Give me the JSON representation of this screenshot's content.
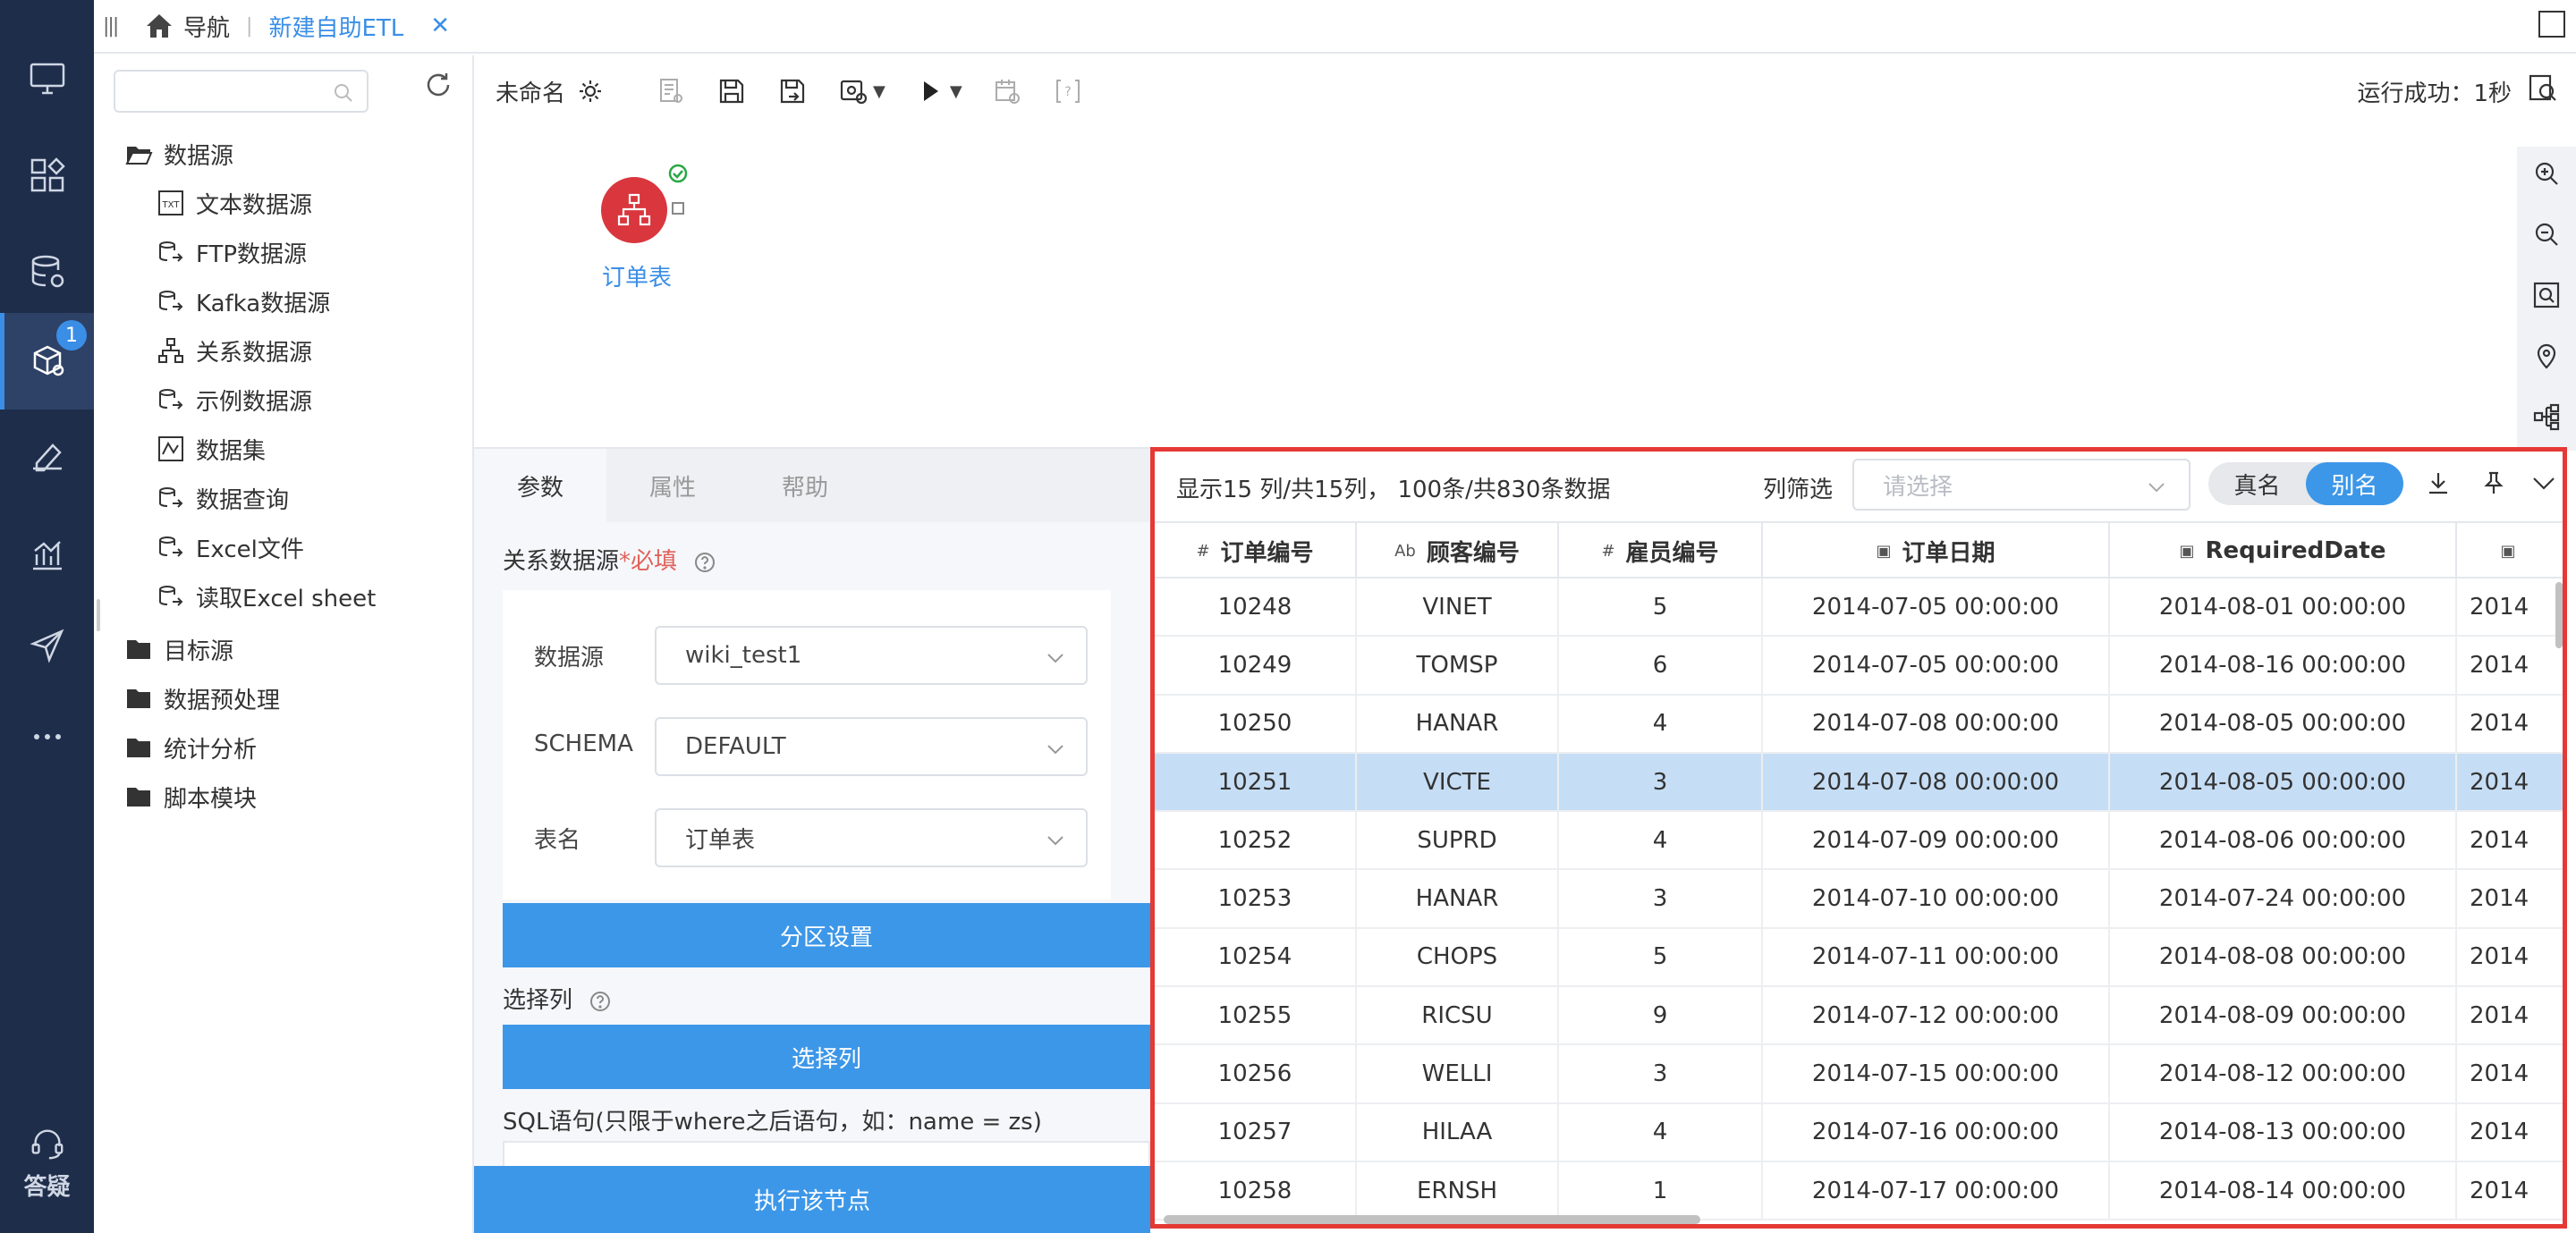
{
  "topbar": {
    "nav_label": "导航",
    "separator": "|",
    "active_tab": "新建自助ETL",
    "close_glyph": "✕"
  },
  "leftnav": {
    "badge_count": "1",
    "help_label": "答疑"
  },
  "tree": {
    "search_placeholder": "",
    "groups": [
      {
        "label": "数据源",
        "expanded": true
      },
      {
        "label": "目标源",
        "expanded": false
      },
      {
        "label": "数据预处理",
        "expanded": false
      },
      {
        "label": "统计分析",
        "expanded": false
      },
      {
        "label": "脚本模块",
        "expanded": false
      }
    ],
    "datasource_items": [
      {
        "label": "文本数据源",
        "icon": "text-file-icon"
      },
      {
        "label": "FTP数据源",
        "icon": "database-link-icon"
      },
      {
        "label": "Kafka数据源",
        "icon": "database-link-icon"
      },
      {
        "label": "关系数据源",
        "icon": "relation-icon"
      },
      {
        "label": "示例数据源",
        "icon": "database-link-icon"
      },
      {
        "label": "数据集",
        "icon": "dataset-icon"
      },
      {
        "label": "数据查询",
        "icon": "database-link-icon"
      },
      {
        "label": "Excel文件",
        "icon": "database-link-icon"
      },
      {
        "label": "读取Excel sheet",
        "icon": "database-link-icon"
      }
    ]
  },
  "toolbar": {
    "flow_name": "未命名",
    "run_status": "运行成功：1秒"
  },
  "canvas": {
    "node_label": "订单表"
  },
  "params": {
    "tabs": [
      "参数",
      "属性",
      "帮助"
    ],
    "active_tab": "参数",
    "section_label": "关系数据源",
    "required_text": "*必填",
    "fields": [
      {
        "label": "数据源",
        "value": "wiki_test1"
      },
      {
        "label": "SCHEMA",
        "value": "DEFAULT"
      },
      {
        "label": "表名",
        "value": "订单表"
      }
    ],
    "partition_button": "分区设置",
    "select_cols_label": "选择列",
    "select_cols_button": "选择列",
    "sql_label": "SQL语句(只限于where之后语句，如：name = zs)",
    "exec_button": "执行该节点"
  },
  "preview": {
    "summary": "显示15 列/共15列，  100条/共830条数据",
    "filter_label": "列筛选",
    "filter_placeholder": "请选择",
    "toggle": [
      "真名",
      "别名"
    ],
    "toggle_active": "别名",
    "columns": [
      {
        "name": "订单编号",
        "type_icon": "#"
      },
      {
        "name": "顾客编号",
        "type_icon": "Ab"
      },
      {
        "name": "雇员编号",
        "type_icon": "#"
      },
      {
        "name": "订单日期",
        "type_icon": "date"
      },
      {
        "name": "RequiredDate",
        "type_icon": "date"
      },
      {
        "name": "",
        "type_icon": "date"
      }
    ],
    "rows": [
      [
        "10248",
        "VINET",
        "5",
        "2014-07-05 00:00:00",
        "2014-08-01 00:00:00",
        "2014"
      ],
      [
        "10249",
        "TOMSP",
        "6",
        "2014-07-05 00:00:00",
        "2014-08-16 00:00:00",
        "2014"
      ],
      [
        "10250",
        "HANAR",
        "4",
        "2014-07-08 00:00:00",
        "2014-08-05 00:00:00",
        "2014"
      ],
      [
        "10251",
        "VICTE",
        "3",
        "2014-07-08 00:00:00",
        "2014-08-05 00:00:00",
        "2014"
      ],
      [
        "10252",
        "SUPRD",
        "4",
        "2014-07-09 00:00:00",
        "2014-08-06 00:00:00",
        "2014"
      ],
      [
        "10253",
        "HANAR",
        "3",
        "2014-07-10 00:00:00",
        "2014-07-24 00:00:00",
        "2014"
      ],
      [
        "10254",
        "CHOPS",
        "5",
        "2014-07-11 00:00:00",
        "2014-08-08 00:00:00",
        "2014"
      ],
      [
        "10255",
        "RICSU",
        "9",
        "2014-07-12 00:00:00",
        "2014-08-09 00:00:00",
        "2014"
      ],
      [
        "10256",
        "WELLI",
        "3",
        "2014-07-15 00:00:00",
        "2014-08-12 00:00:00",
        "2014"
      ],
      [
        "10257",
        "HILAA",
        "4",
        "2014-07-16 00:00:00",
        "2014-08-13 00:00:00",
        "2014"
      ],
      [
        "10258",
        "ERNSH",
        "1",
        "2014-07-17 00:00:00",
        "2014-08-14 00:00:00",
        "2014"
      ]
    ],
    "selected_row": 3
  },
  "colors": {
    "nav_bg": "#1e2d4a",
    "accent": "#3d97e8",
    "node_red": "#d9363e",
    "highlight_border": "#e53935",
    "selected_row": "#c6def5"
  }
}
